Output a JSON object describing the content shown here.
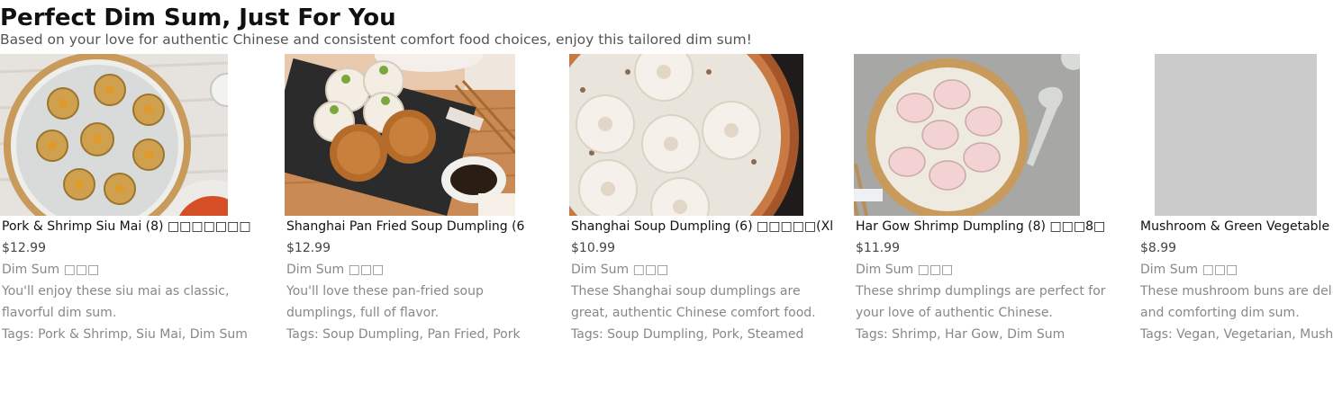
{
  "header": {
    "title": "Perfect Dim Sum, Just For You",
    "subtitle": "Based on your love for authentic Chinese and consistent comfort food choices, enjoy this tailored dim sum!"
  },
  "items": [
    {
      "name": "Pork & Shrimp Siu Mai (8) □□□□□□□",
      "price": "$12.99",
      "category": "Dim Sum □□□",
      "description": "You'll enjoy these siu mai as classic, flavorful dim sum.",
      "tags": "Tags: Pork & Shrimp, Siu Mai, Dim Sum",
      "image": "siu-mai-photo"
    },
    {
      "name": "Shanghai Pan Fried Soup Dumpling (6",
      "price": "$12.99",
      "category": "Dim Sum □□□",
      "description": "You'll love these pan-fried soup dumplings, full of flavor.",
      "tags": "Tags: Soup Dumpling, Pan Fried, Pork",
      "image": "pan-fried-dumpling-photo"
    },
    {
      "name": "Shanghai Soup Dumpling (6) □□□□□(Xl",
      "price": "$10.99",
      "category": "Dim Sum □□□",
      "description": "These Shanghai soup dumplings are great, authentic Chinese comfort food.",
      "tags": "Tags: Soup Dumpling, Pork, Steamed",
      "image": "soup-dumpling-photo"
    },
    {
      "name": "Har Gow Shrimp Dumpling (8) □□□8□",
      "price": "$11.99",
      "category": "Dim Sum □□□",
      "description": "These shrimp dumplings are perfect for your love of authentic Chinese.",
      "tags": "Tags: Shrimp, Har Gow, Dim Sum",
      "image": "har-gow-photo"
    },
    {
      "name": "Mushroom & Green Vegetable",
      "price": "$8.99",
      "category": "Dim Sum □□□",
      "description": "These mushroom buns are delightful, savory, and comforting dim sum.",
      "tags": "Tags: Vegan, Vegetarian, Mushroom",
      "image": "placeholder-gray"
    }
  ]
}
